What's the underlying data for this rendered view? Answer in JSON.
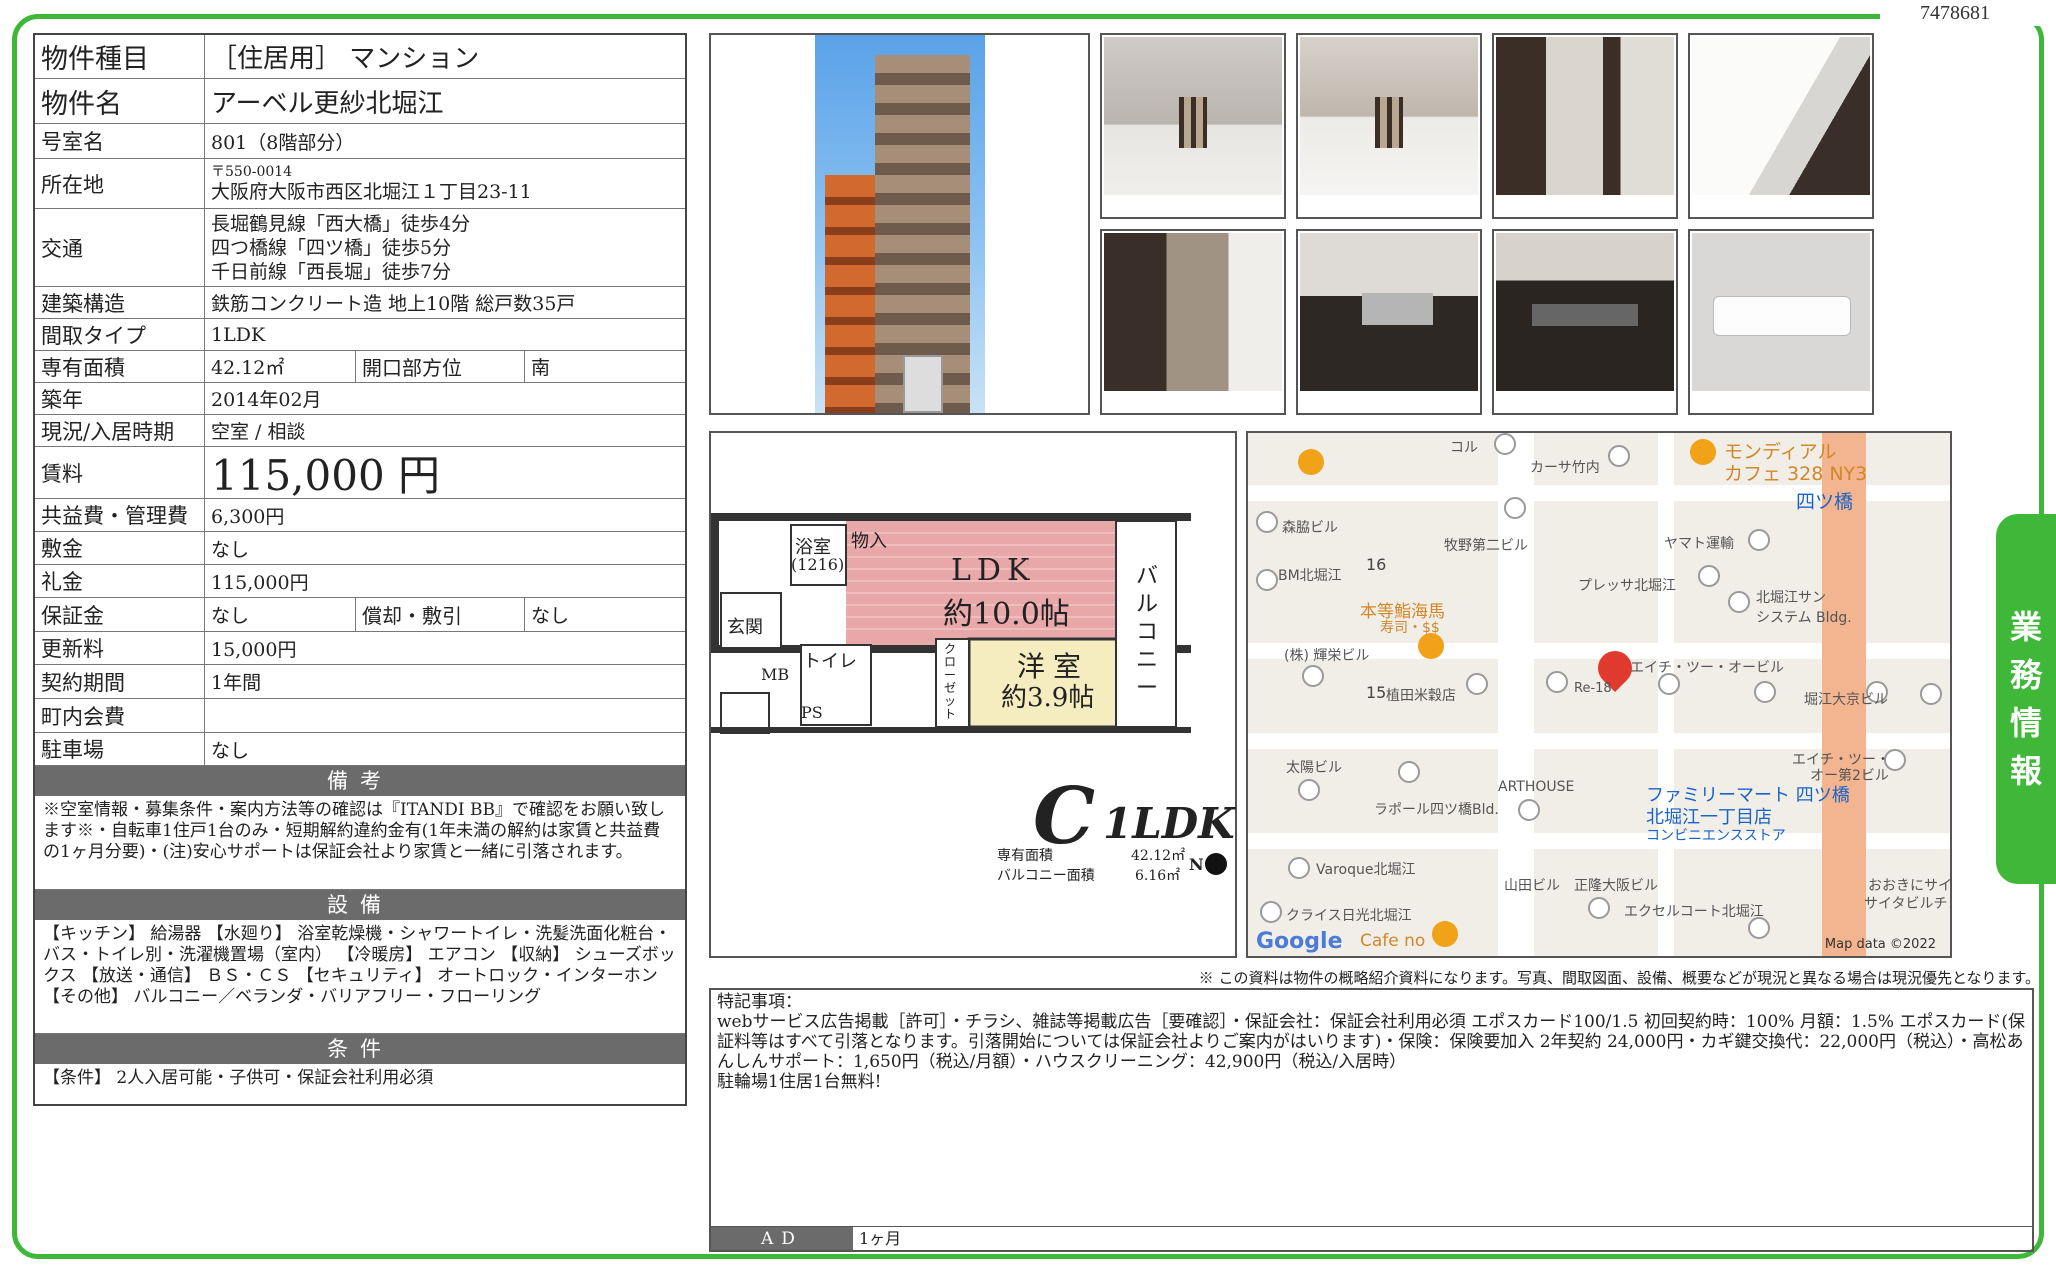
{
  "doc_id": "7478681",
  "side_tab": [
    "業",
    "務",
    "情",
    "報"
  ],
  "info": {
    "type_label": "物件種目",
    "type_value": "［住居用］ マンション",
    "name_label": "物件名",
    "name_value": "アーベル更紗北堀江",
    "room_label": "号室名",
    "room_value": "801（8階部分）",
    "address_label": "所在地",
    "address_zip": "〒550-0014",
    "address_value": "大阪府大阪市西区北堀江１丁目23-11",
    "access_label": "交通",
    "access": [
      "長堀鶴見線「西大橋」徒歩4分",
      "四つ橋線「四ツ橋」徒歩5分",
      "千日前線「西長堀」徒歩7分"
    ],
    "structure_label": "建築構造",
    "structure_value": "鉄筋コンクリート造 地上10階 総戸数35戸",
    "layout_label": "間取タイプ",
    "layout_value": "1LDK",
    "area_label": "専有面積",
    "area_value": "42.12㎡",
    "direction_label": "開口部方位",
    "direction_value": "南",
    "built_label": "築年",
    "built_value": "2014年02月",
    "status_label": "現況/入居時期",
    "status_value": "空室 / 相談",
    "rent_label": "賃料",
    "rent_value": "115,000 円",
    "fee_label": "共益費・管理費",
    "fee_value": "6,300円",
    "shikikin_label": "敷金",
    "shikikin_value": "なし",
    "reikin_label": "礼金",
    "reikin_value": "115,000円",
    "deposit_label": "保証金",
    "deposit_value": "なし",
    "amort_label": "償却・敷引",
    "amort_value": "なし",
    "renewal_label": "更新料",
    "renewal_value": "15,000円",
    "period_label": "契約期間",
    "period_value": "1年間",
    "town_label": "町内会費",
    "town_value": "",
    "parking_label": "駐車場",
    "parking_value": "なし"
  },
  "sections": {
    "remarks_title": "備考",
    "remarks_text": "※空室情報・募集条件・案内方法等の確認は『ITANDI BB』で確認をお願い致します※・自転車1住戸1台のみ・短期解約違約金有(1年未満の解約は家賃と共益費の1ヶ月分要)・(注)安心サポートは保証会社より家賃と一緒に引落されます。",
    "equipment_title": "設備",
    "equipment_text": "【キッチン】 給湯器 【水廻り】 浴室乾燥機・シャワートイレ・洗髪洗面化粧台・バス・トイレ別・洗濯機置場（室内） 【冷暖房】 エアコン 【収納】 シューズボックス 【放送・通信】 ＢＳ・ＣＳ 【セキュリティ】 オートロック・インターホン 【その他】 バルコニー／ベランダ・バリアフリー・フローリング",
    "conditions_title": "条件",
    "conditions_text": "【条件】 2人入居可能・子供可・保証会社利用必須"
  },
  "floorplan": {
    "ldk": "LDK",
    "ldk_size": "約10.0帖",
    "western": "洋室",
    "western_size": "約3.9帖",
    "bath": "浴室",
    "bath_size": "(1216)",
    "storage": "物入",
    "entrance": "玄関",
    "toilet": "トイレ",
    "closet": "クローゼット",
    "balcony": "バルコニー",
    "mb": "MB",
    "ps": "PS",
    "type_letter": "C",
    "type_name": "1LDK",
    "area_label": "専有面積",
    "area_value": "42.12㎡",
    "balcony_label": "バルコニー面積",
    "balcony_value": "6.16㎡",
    "north": "N"
  },
  "map": {
    "labels": [
      "コル",
      "カーサ竹内",
      "モンディアル",
      "カフェ 328 NY3",
      "四ツ橋",
      "森脇ビル",
      "牧野第二ビル",
      "ヤマト運輸",
      "BM北堀江",
      "16",
      "本等鮨海馬",
      "寿司・$$",
      "プレッサ北堀江",
      "北堀江サン",
      "システム Bldg.",
      "(株) 輝栄ビル",
      "エイチ・ツー・オービル",
      "15",
      "植田米穀店",
      "Re-18",
      "堀江大京ビル",
      "太陽ビル",
      "ARTHOUSE",
      "ラポール四ツ橋Bld.",
      "ファミリーマート 四ツ橋",
      "北堀江一丁目店",
      "コンビニエンスストア",
      "エイチ・ツー・",
      "オー第2ビル",
      "Varoque北堀江",
      "山田ビル",
      "正隆大阪ビル",
      "おおきにサイ",
      "サイタビルチン",
      "クライス日光北堀江",
      "エクセルコート北堀江",
      "Cafe no"
    ],
    "google": "Google",
    "map_data": "Map data ©2022"
  },
  "disclaimer": "※ この資料は物件の概略紹介資料になります。写真、間取図面、設備、概要などが現況と異なる場合は現況優先となります。",
  "special": {
    "heading": "特記事項：",
    "text": "webサービス広告掲載［許可］・チラシ、雑誌等掲載広告［要確認］・保証会社：保証会社利用必須 エポスカード100/1.5 初回契約時：100% 月額：1.5% エポスカード(保証料等はすべて引落となります。引落開始については保証会社よりご案内がはいります)・保険：保険要加入 2年契約 24,000円・カギ鍵交換代：22,000円（税込）・高松あんしんサポート：1,650円（税込/月額）・ハウスクリーニング：42,900円（税込/入居時）",
    "text2": "駐輪場1住居1台無料!",
    "ad_label": "AD",
    "ad_value": "1ヶ月"
  },
  "colors": {
    "frame": "#3fb83a",
    "section_bg": "#6b6b6b",
    "pin_red": "#e03a2e"
  }
}
